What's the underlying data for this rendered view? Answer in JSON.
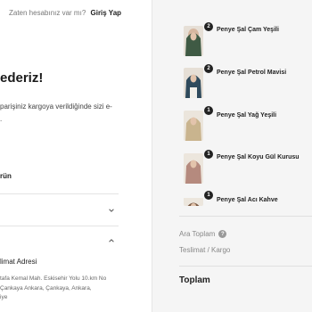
{
  "login": {
    "prompt": "Zaten hesabınız var mı?",
    "link": "Giriş Yap"
  },
  "confirmation": {
    "title": "ederiz!",
    "description_line1": "parişiniz kargoya verildiğinde sizi e-",
    "description_line2": "."
  },
  "sections": {
    "products_label": "rün",
    "address_label": "limat Adresi",
    "address_lines": [
      "tafa Kemal Mah. Eskisehir Yolu 10.km No",
      "Çankaya Ankara, Çankaya, Ankara,",
      "iye"
    ]
  },
  "cart": {
    "items": [
      {
        "name": "Penye Şal Çam Yeşili",
        "quantity": "2"
      },
      {
        "name": "Penye Şal Petrol Mavisi",
        "quantity": "2"
      },
      {
        "name": "Penye Şal Yağ Yeşili",
        "quantity": "1"
      },
      {
        "name": "Penye Şal Koyu Gül Kurusu",
        "quantity": "1"
      },
      {
        "name": "Penye Şal Acı Kahve",
        "quantity": "1"
      }
    ]
  },
  "summary": {
    "subtotal_label": "Ara Toplam",
    "shipping_label": "Teslimat / Kargo",
    "total_label": "Toplam"
  },
  "icons": {
    "chevron_down": "chevron-down-icon",
    "chevron_up": "chevron-up-icon",
    "info": "info-icon"
  },
  "colors": {
    "scarf_1": "#3f5a44",
    "scarf_2": "#2f4a5c",
    "scarf_3": "#8a8a4a",
    "scarf_4": "#8e5a5a",
    "scarf_5": "#5a3b2a"
  }
}
